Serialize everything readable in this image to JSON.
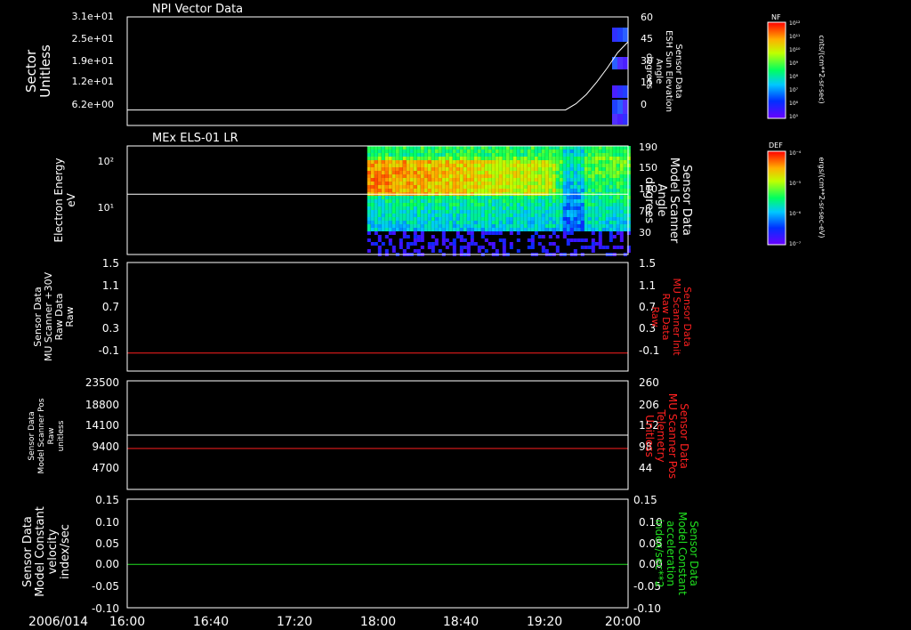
{
  "date_label": "2006/014",
  "time_ticks": [
    "16:00",
    "16:40",
    "17:20",
    "18:00",
    "18:40",
    "19:20",
    "20:00"
  ],
  "time_range_minutes": [
    0,
    240
  ],
  "colors": {
    "frame": "#ffffff",
    "trace_white": "#ffffff",
    "trace_red": "#ff2020",
    "trace_green": "#20e020",
    "label_red": "#ff2020",
    "label_green": "#20e020"
  },
  "panels": [
    {
      "id": "npi",
      "title": "NPI Vector Data",
      "left_label": [
        "Sector",
        "Unitless"
      ],
      "left_ticks": [
        "3.1e+01",
        "2.5e+01",
        "1.9e+01",
        "1.2e+01",
        "6.2e+00"
      ],
      "right_label": [
        "Sensor Data",
        "ESH Sun Elevation",
        "Angle",
        "degrees"
      ],
      "right_ticks": [
        "60",
        "45",
        "30",
        "15",
        "0"
      ],
      "right_label_color": "#ffffff"
    },
    {
      "id": "els",
      "title": "MEx ELS-01 LR",
      "left_label": [
        "Electron Energy",
        "eV"
      ],
      "left_ticks": [
        "10²",
        "10¹"
      ],
      "right_label": [
        "Sensor Data",
        "Model Scanner",
        "Angle",
        "degrees"
      ],
      "right_ticks": [
        "190",
        "150",
        "110",
        "70",
        "30"
      ],
      "right_label_color": "#ffffff"
    },
    {
      "id": "mu_raw",
      "title": "",
      "left_label": [
        "Sensor Data",
        "MU Scanner +30V",
        "Raw Data",
        "Raw"
      ],
      "left_ticks": [
        "1.5",
        "1.1",
        "0.7",
        "0.3",
        "-0.1"
      ],
      "right_label": [
        "Sensor Data",
        "MU Scanner Init",
        "Raw Data",
        "Raw"
      ],
      "right_ticks": [
        "1.5",
        "1.1",
        "0.7",
        "0.3",
        "-0.1"
      ],
      "right_label_color": "#ff2020"
    },
    {
      "id": "scanner_pos",
      "title": "",
      "left_label": [
        "Sensor Data",
        "Model Scanner Pos",
        "Raw",
        "unitless"
      ],
      "left_ticks": [
        "23500",
        "18800",
        "14100",
        "9400",
        "4700"
      ],
      "right_label": [
        "Sensor Data",
        "MU Scanner Pos",
        "Telemetry",
        "Unitless"
      ],
      "right_ticks": [
        "260",
        "206",
        "152",
        "98",
        "44"
      ],
      "right_label_color": "#ff2020"
    },
    {
      "id": "velocity",
      "title": "",
      "left_label": [
        "Sensor Data",
        "Model Constant",
        "velocity",
        "index/sec"
      ],
      "left_ticks": [
        "0.15",
        "0.10",
        "0.05",
        "0.00",
        "-0.05",
        "-0.10"
      ],
      "right_label": [
        "Sensor Data",
        "Model Constant",
        "acceleration",
        "index/sec**2"
      ],
      "right_ticks": [
        "0.15",
        "0.10",
        "0.05",
        "0.00",
        "-0.05",
        "-0.10"
      ],
      "right_label_color": "#20e020"
    }
  ],
  "colorbars": [
    {
      "id": "nf",
      "label": "NF",
      "unit": "cnts/(cm**2-sr-sec)",
      "ticks": [
        "10¹²",
        "10¹¹",
        "10¹⁰",
        "10⁹",
        "10⁸",
        "10⁷",
        "10⁶",
        "10⁵"
      ]
    },
    {
      "id": "def",
      "label": "DEF",
      "unit": "ergs/(cm**2-sr-sec-eV)",
      "ticks": [
        "10⁻⁴",
        "10⁻⁵",
        "10⁻⁶",
        "10⁻⁷"
      ]
    }
  ],
  "chart_data": [
    {
      "type": "line",
      "panel": "npi",
      "title": "NPI Vector Data",
      "ylabel": "Sector Unitless",
      "y2label": "Sensor Data ESH Sun Elevation Angle degrees",
      "y2lim": [
        -10,
        60
      ],
      "series": [
        {
          "name": "ESH Sun Elevation Angle",
          "axis": "right",
          "x_minutes": [
            0,
            210,
            215,
            220,
            225,
            230,
            235,
            240
          ],
          "values": [
            0,
            0,
            4,
            10,
            18,
            27,
            37,
            44
          ]
        }
      ]
    },
    {
      "type": "heatmap",
      "panel": "els",
      "title": "MEx ELS-01 LR",
      "ylabel": "Electron Energy eV",
      "yscale": "log",
      "ylim": [
        1.5,
        200
      ],
      "data_start_minutes": 115,
      "y2label": "Sensor Data Model Scanner Angle degrees",
      "y2lim": [
        10,
        190
      ],
      "series": [
        {
          "name": "Model Scanner Angle",
          "axis": "right",
          "x_minutes": [
            0,
            240
          ],
          "values": [
            110,
            110
          ]
        }
      ]
    },
    {
      "type": "line",
      "panel": "mu_raw",
      "ylabel": "Sensor Data MU Scanner +30V Raw Data Raw",
      "ylim": [
        -0.3,
        1.5
      ],
      "y2label": "Sensor Data MU Scanner Init Raw Data Raw",
      "series": [
        {
          "name": "MU Scanner Init",
          "color": "#ff2020",
          "x_minutes": [
            0,
            240
          ],
          "values": [
            0.0,
            0.0
          ]
        }
      ]
    },
    {
      "type": "line",
      "panel": "scanner_pos",
      "ylabel": "Sensor Data Model Scanner Pos Raw unitless",
      "ylim": [
        0,
        23500
      ],
      "y2label": "Sensor Data MU Scanner Pos Telemetry Unitless",
      "y2lim": [
        0,
        260
      ],
      "series": [
        {
          "name": "Model Scanner Pos",
          "axis": "left",
          "color": "#ffffff",
          "x_minutes": [
            0,
            240
          ],
          "values": [
            11750,
            11750
          ]
        },
        {
          "name": "MU Scanner Pos Telemetry",
          "axis": "right",
          "color": "#ff2020",
          "x_minutes": [
            0,
            240
          ],
          "values": [
            98,
            98
          ]
        }
      ]
    },
    {
      "type": "line",
      "panel": "velocity",
      "ylabel": "Sensor Data Model Constant velocity index/sec",
      "ylim": [
        -0.1,
        0.15
      ],
      "y2label": "Sensor Data Model Constant acceleration index/sec**2",
      "series": [
        {
          "name": "Model Constant velocity",
          "color": "#20e020",
          "x_minutes": [
            0,
            240
          ],
          "values": [
            0.0,
            0.0
          ]
        }
      ]
    }
  ]
}
